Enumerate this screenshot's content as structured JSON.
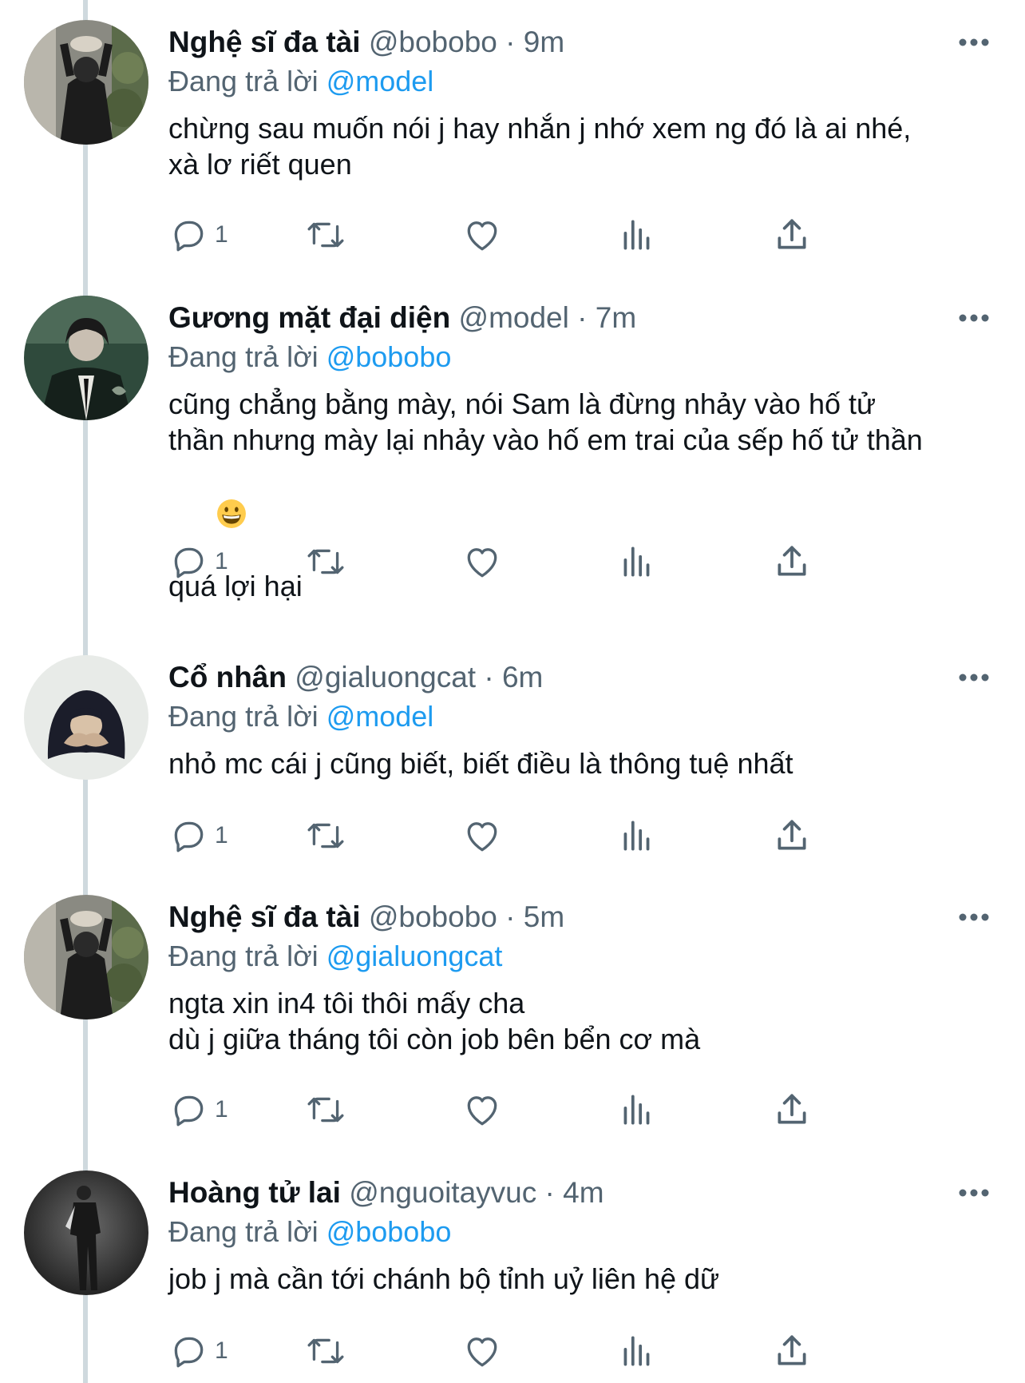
{
  "tweets": [
    {
      "name": "Nghệ sĩ đa tài",
      "handle": "@bobobo",
      "time": "· 9m",
      "replying_prefix": "Đang trả lời ",
      "replying_to": "@model",
      "content": [
        "chừng sau muốn nói j hay nhắn j nhớ xem ng đó là ai nhé,",
        "xà lơ riết quen"
      ],
      "reply_count": "1"
    },
    {
      "name": "Gương mặt đại diện",
      "handle": "@model",
      "time": "· 7m",
      "replying_prefix": "Đang trả lời ",
      "replying_to": "@bobobo",
      "content": [
        "cũng chẳng bằng mày, nói Sam là đừng nhảy vào hố tử",
        "thần nhưng mày lại nhảy vào hố em trai của sếp hố tử thần",
        "",
        "quá lợi hại"
      ],
      "reply_count": "1"
    },
    {
      "name": "Cổ nhân",
      "handle": "@gialuongcat",
      "time": "· 6m",
      "replying_prefix": "Đang trả lời ",
      "replying_to": "@model",
      "content": [
        "nhỏ mc cái j cũng biết, biết điều là thông tuệ nhất"
      ],
      "reply_count": "1"
    },
    {
      "name": "Nghệ sĩ đa tài",
      "handle": "@bobobo",
      "time": "· 5m",
      "replying_prefix": "Đang trả lời ",
      "replying_to": "@gialuongcat",
      "content": [
        "ngta xin in4 tôi thôi mấy cha",
        "dù j giữa tháng tôi còn job bên bển cơ mà"
      ],
      "reply_count": "1"
    },
    {
      "name": "Hoàng tử lai",
      "handle": "@nguoitayvuc",
      "time": "· 4m",
      "replying_prefix": "Đang trả lời ",
      "replying_to": "@bobobo",
      "content": [
        "job j mà cần tới chánh bộ tỉnh uỷ liên hệ dữ"
      ],
      "reply_count": "1"
    }
  ],
  "icons": {
    "reply": "reply-icon",
    "retweet": "retweet-icon",
    "like": "heart-icon",
    "views": "views-icon",
    "share": "share-icon",
    "more": "more-icon",
    "emoji": "grinning-face-emoji"
  },
  "colors": {
    "text": "#0f1419",
    "muted": "#536471",
    "mention": "#1d9bf0",
    "thread_line": "#cfd9de"
  }
}
